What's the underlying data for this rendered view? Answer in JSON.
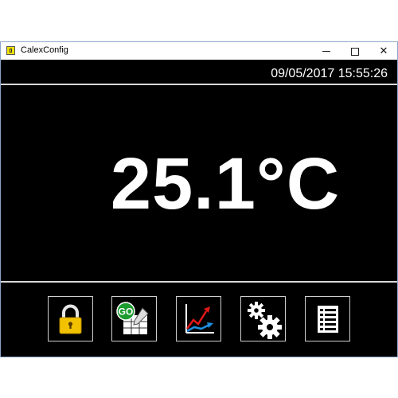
{
  "window": {
    "title": "CalexConfig",
    "icon": "app-icon",
    "controls": {
      "minimize": "minimize-icon",
      "maximize": "maximize-icon",
      "close": "✕"
    }
  },
  "status": {
    "datetime": "09/05/2017 15:55:26"
  },
  "reading": {
    "temperature": "25.1°C"
  },
  "toolbar": [
    {
      "icon": "lock-icon"
    },
    {
      "icon": "go-logging-icon",
      "badge": "GO"
    },
    {
      "icon": "chart-icon"
    },
    {
      "icon": "settings-gears-icon"
    },
    {
      "icon": "list-icon"
    }
  ],
  "colors": {
    "background": "#000000",
    "text": "#ffffff",
    "lock": "#f2c200",
    "badge": "#1c9b2e",
    "chart_red": "#e01818",
    "chart_blue": "#1e8fe0"
  }
}
